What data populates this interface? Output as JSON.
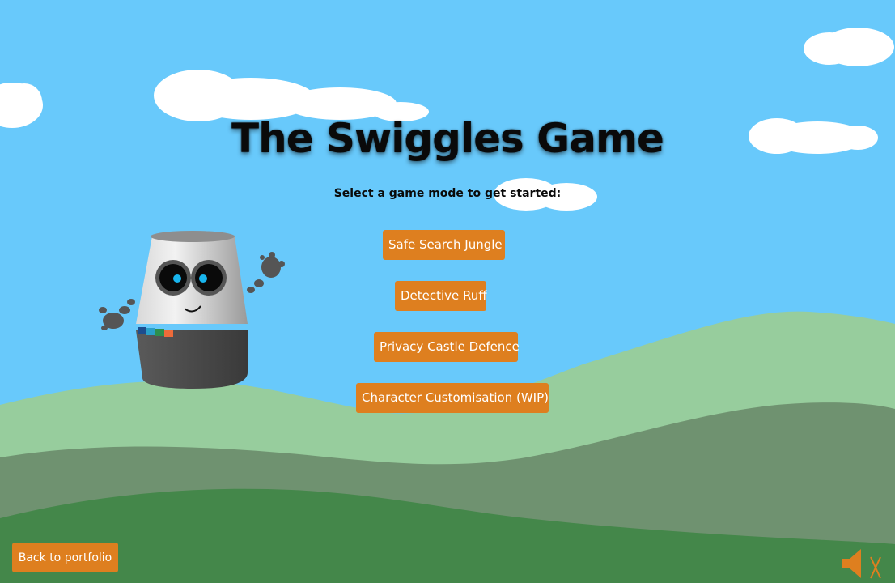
{
  "game": {
    "title": "The Swiggles Game",
    "subtitle": "Select a game mode to get started:"
  },
  "modes": [
    {
      "label": "Safe Search Jungle"
    },
    {
      "label": "Detective Ruff"
    },
    {
      "label": "Privacy Castle Defence"
    },
    {
      "label": "Character Customisation (WIP)"
    }
  ],
  "footer": {
    "back_label": "Back to portfolio",
    "sound_icon": "speaker-muted-icon"
  },
  "colors": {
    "sky": "#68c9fb",
    "button": "#de7f1f",
    "hill_far": "#97cd9d",
    "hill_mid": "#6f9270",
    "hill_near": "#44874a"
  }
}
